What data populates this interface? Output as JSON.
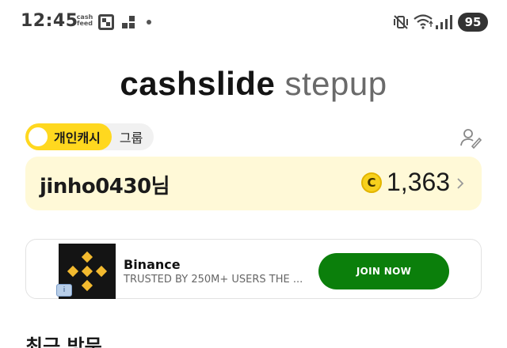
{
  "status_bar": {
    "time": "12:45",
    "cashfeed_badge": "cash feed",
    "battery": "95",
    "icons": [
      "qr-code-icon",
      "notification-blocks-icon",
      "dot-icon",
      "mute-vibrate-icon",
      "wifi-icon",
      "signal-icon",
      "battery-icon"
    ]
  },
  "brand": {
    "part1": "cashslide",
    "part2": "stepup"
  },
  "tabs": {
    "personal": "개인캐시",
    "group": "그룹"
  },
  "user": {
    "name": "jinho0430님",
    "coin_symbol": "C",
    "balance": "1,363"
  },
  "ad": {
    "title": "Binance",
    "subtitle": "TRUSTED BY 250M+ USERS THE ...",
    "cta": "JOIN NOW",
    "info_badge": "i",
    "colors": {
      "cta": "#0b7f0b",
      "logo_bg": "#141414",
      "logo_mark": "#f3ba2f"
    }
  },
  "section": {
    "title": "최근 방문"
  },
  "colors": {
    "accent": "#ffd81f",
    "card_bg": "#fff9d7"
  }
}
